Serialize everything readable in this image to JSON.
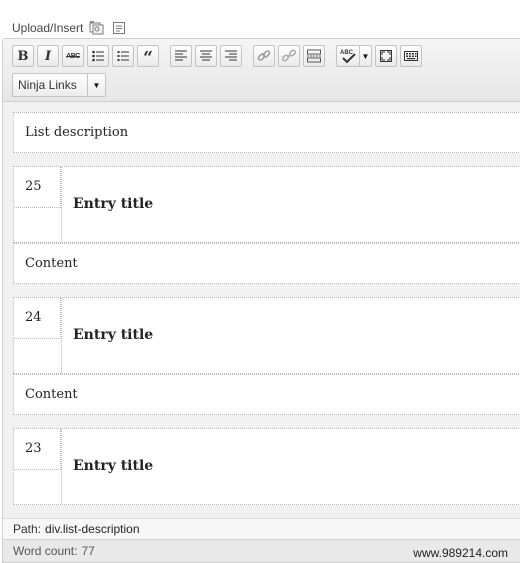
{
  "upload": {
    "label": "Upload/Insert",
    "icons": [
      "add-media-icon",
      "add-form-icon"
    ]
  },
  "toolbar": {
    "bold_label": "B",
    "italic_label": "I",
    "strike_label": "ABC",
    "quote_label": "“",
    "spell_label": "ABC",
    "format_select": "Ninja Links",
    "icons": [
      "bold-icon",
      "italic-icon",
      "strikethrough-icon",
      "bulleted-list-icon",
      "numbered-list-icon",
      "blockquote-icon",
      "align-left-icon",
      "align-center-icon",
      "align-right-icon",
      "insert-link-icon",
      "unlink-icon",
      "insert-more-icon",
      "spellcheck-icon",
      "fullscreen-icon",
      "kitchen-sink-icon"
    ]
  },
  "content": {
    "list_description": "List description",
    "entries": [
      {
        "number": "25",
        "title": "Entry title",
        "content": "Content"
      },
      {
        "number": "24",
        "title": "Entry title",
        "content": "Content"
      },
      {
        "number": "23",
        "title": "Entry title"
      }
    ]
  },
  "status": {
    "path_label": "Path:",
    "path_value": "div.list-description",
    "word_count_label": "Word count:",
    "word_count": "77"
  },
  "watermark": "www.989214.com"
}
